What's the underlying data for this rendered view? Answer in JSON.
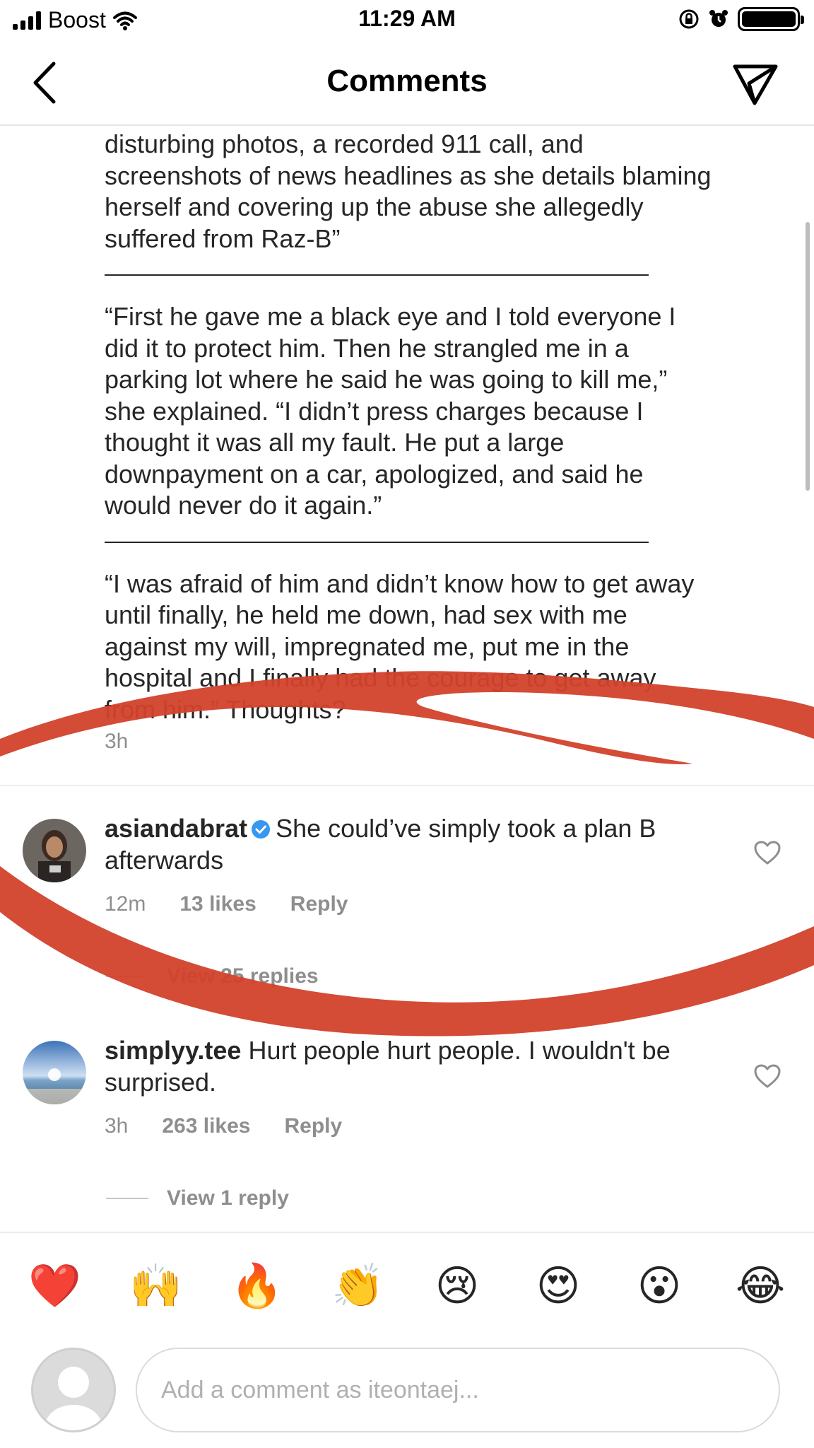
{
  "status_bar": {
    "carrier": "Boost",
    "time": "11:29 AM"
  },
  "nav": {
    "title": "Comments"
  },
  "caption": {
    "paragraph1": "disturbing photos, a recorded 911 call, and\nscreenshots of news headlines as she details blaming\nherself and covering up the abuse she allegedly\nsuffered from Raz-B”",
    "paragraph2": "“First he gave me a black eye and I told everyone I\ndid it to protect him. Then he strangled me in a\nparking lot where he said he was going to kill me,”\nshe explained. “I didn’t press charges because I\nthought it was all my fault. He put a large\ndownpayment on a car, apologized, and said he\nwould never do it again.”",
    "paragraph3": "“I was afraid of him and didn’t know how to get away\nuntil finally, he held me down, had sex with me\nagainst my will, impregnated me, put me in the\nhospital and I finally had the courage to get away\nfrom him.” Thoughts?",
    "time": "3h"
  },
  "comments": [
    {
      "username": "asiandabrat",
      "verified": true,
      "text": "She could’ve simply took a plan B afterwards",
      "time": "12m",
      "likes": "13 likes",
      "reply_label": "Reply",
      "view_replies": "View 25 replies"
    },
    {
      "username": "simplyy.tee",
      "verified": false,
      "text": "Hurt people hurt people. I wouldn't be surprised.",
      "time": "3h",
      "likes": "263 likes",
      "reply_label": "Reply",
      "view_replies": "View 1 reply"
    }
  ],
  "emoji_bar": [
    "❤️",
    "🙌",
    "🔥",
    "👏",
    "😢",
    "😍",
    "😮",
    "😂"
  ],
  "composer": {
    "placeholder": "Add a comment as iteontaej..."
  },
  "colors": {
    "markup_red": "#d2412b",
    "secondary_text": "#8e8e8e",
    "verified_blue": "#3897f0"
  }
}
